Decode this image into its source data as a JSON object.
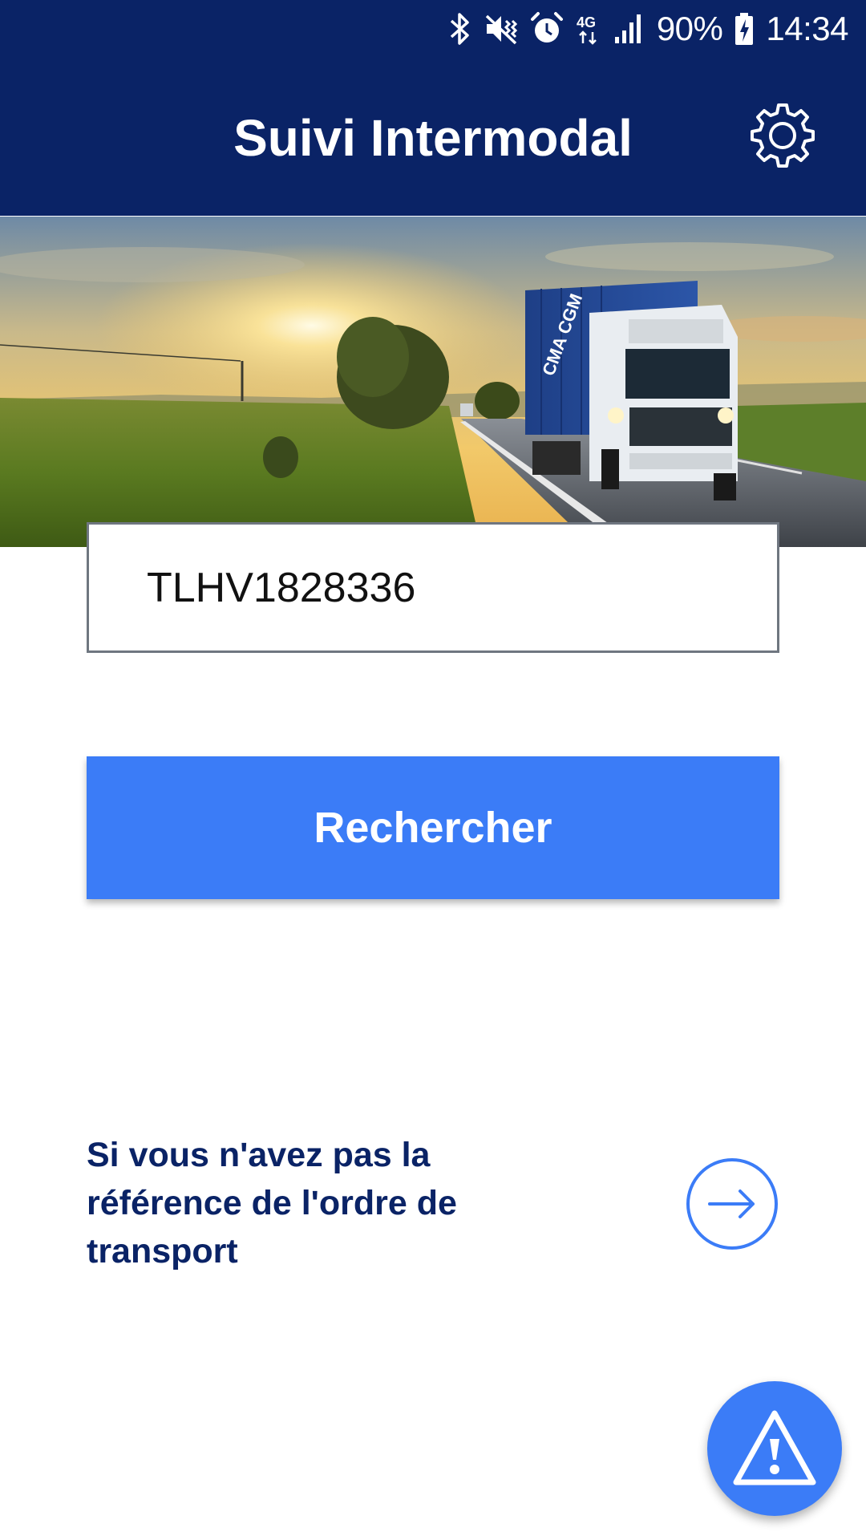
{
  "status_bar": {
    "battery": "90%",
    "time": "14:34",
    "network": "4G",
    "icons": [
      "bluetooth-icon",
      "vibrate-icon",
      "alarm-icon",
      "network-4g-icon",
      "signal-icon",
      "battery-charging-icon"
    ]
  },
  "app_bar": {
    "title": "Suivi Intermodal",
    "settings_icon": "gear-icon"
  },
  "hero": {
    "trailer_brand": "CMA CGM"
  },
  "search": {
    "value": "TLHV1828336",
    "button_label": "Rechercher"
  },
  "no_reference": {
    "text": "Si vous n'avez pas la référence de l'ordre de transport",
    "icon": "arrow-right-circle-icon"
  },
  "fab": {
    "icon": "warning-icon"
  },
  "colors": {
    "header": "#0a2366",
    "accent": "#3b7cf7",
    "text_dark_blue": "#0a2366"
  }
}
